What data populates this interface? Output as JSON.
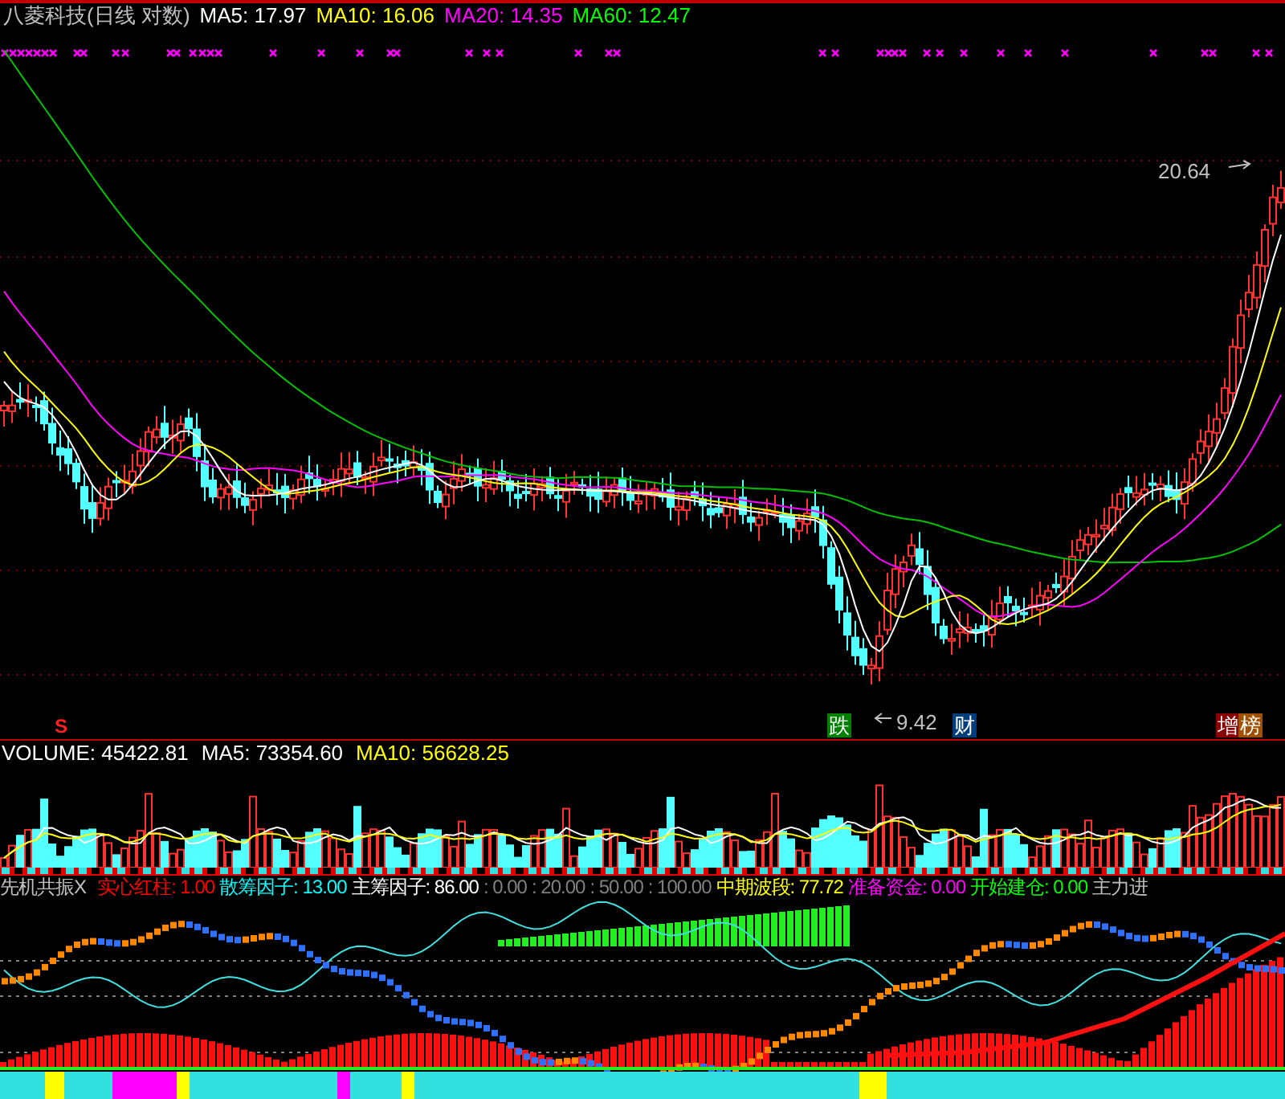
{
  "main": {
    "title": "八菱科技(日线 对数)",
    "ma": [
      {
        "label": "MA5: 17.97",
        "color": "#ffffff"
      },
      {
        "label": "MA10: 16.06",
        "color": "#ffff00"
      },
      {
        "label": "MA20: 14.35",
        "color": "#ff00ff"
      },
      {
        "label": "MA60: 12.47",
        "color": "#00ff00"
      }
    ],
    "high_label": "20.64",
    "low_label": "9.42",
    "signal_mark": "S",
    "badges": [
      {
        "text": "跌",
        "color": "#008000"
      },
      {
        "text": "财",
        "color": "#003d7a"
      },
      {
        "text": "增",
        "color": "#8b0000"
      },
      {
        "text": "榜",
        "color": "#a05000"
      }
    ]
  },
  "volume": {
    "items": [
      {
        "label": "VOLUME: 45422.81",
        "color": "#ffffff"
      },
      {
        "label": "MA5: 73354.60",
        "color": "#ffffff"
      },
      {
        "label": "MA10: 56628.25",
        "color": "#ffff00"
      }
    ]
  },
  "indicator": {
    "name": "先机共振X",
    "items": [
      {
        "label": "实心红柱: 1.00",
        "color": "#ff0000"
      },
      {
        "label": "散筹因子: 13.00",
        "color": "#00ffff"
      },
      {
        "label": "主筹因子: 86.00",
        "color": "#ffffff"
      },
      {
        "label": ": 0.00",
        "color": "#808080"
      },
      {
        "label": ": 20.00",
        "color": "#808080"
      },
      {
        "label": ": 50.00",
        "color": "#808080"
      },
      {
        "label": ": 100.00",
        "color": "#808080"
      },
      {
        "label": "中期波段: 77.72",
        "color": "#ffff00"
      },
      {
        "label": "准备资金: 0.00",
        "color": "#ff00ff"
      },
      {
        "label": "开始建仓: 0.00",
        "color": "#00ff00"
      },
      {
        "label": "主力进",
        "color": "#c0c0c0"
      }
    ]
  }
}
